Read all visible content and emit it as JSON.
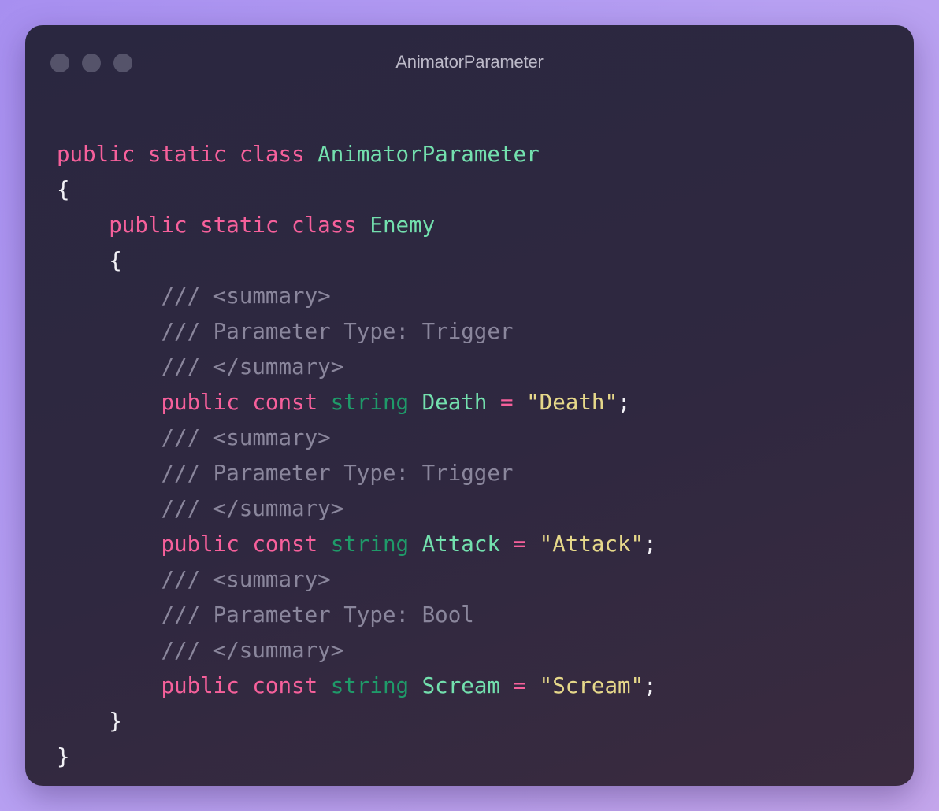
{
  "window": {
    "title": "AnimatorParameter"
  },
  "colors": {
    "keyword": "#f6609b",
    "class_name": "#73e0ae",
    "type": "#1f9a69",
    "string": "#e6d88a",
    "comment": "#8a869c",
    "punctuation": "#f2f1f6"
  },
  "code": {
    "l1": {
      "kw1": "public",
      "kw2": "static",
      "kw3": "class",
      "name": "AnimatorParameter"
    },
    "l2": {
      "brace": "{"
    },
    "l3": {
      "kw1": "public",
      "kw2": "static",
      "kw3": "class",
      "name": "Enemy"
    },
    "l4": {
      "brace": "{"
    },
    "l5": {
      "comment": "/// <summary>"
    },
    "l6": {
      "comment": "/// Parameter Type: Trigger"
    },
    "l7": {
      "comment": "/// </summary>"
    },
    "l8": {
      "kw1": "public",
      "kw2": "const",
      "type": "string",
      "name": "Death",
      "op": "=",
      "value": "\"Death\"",
      "end": ";"
    },
    "l9": {
      "comment": "/// <summary>"
    },
    "l10": {
      "comment": "/// Parameter Type: Trigger"
    },
    "l11": {
      "comment": "/// </summary>"
    },
    "l12": {
      "kw1": "public",
      "kw2": "const",
      "type": "string",
      "name": "Attack",
      "op": "=",
      "value": "\"Attack\"",
      "end": ";"
    },
    "l13": {
      "comment": "/// <summary>"
    },
    "l14": {
      "comment": "/// Parameter Type: Bool"
    },
    "l15": {
      "comment": "/// </summary>"
    },
    "l16": {
      "kw1": "public",
      "kw2": "const",
      "type": "string",
      "name": "Scream",
      "op": "=",
      "value": "\"Scream\"",
      "end": ";"
    },
    "l17": {
      "brace": "}"
    },
    "l18": {
      "brace": "}"
    }
  }
}
